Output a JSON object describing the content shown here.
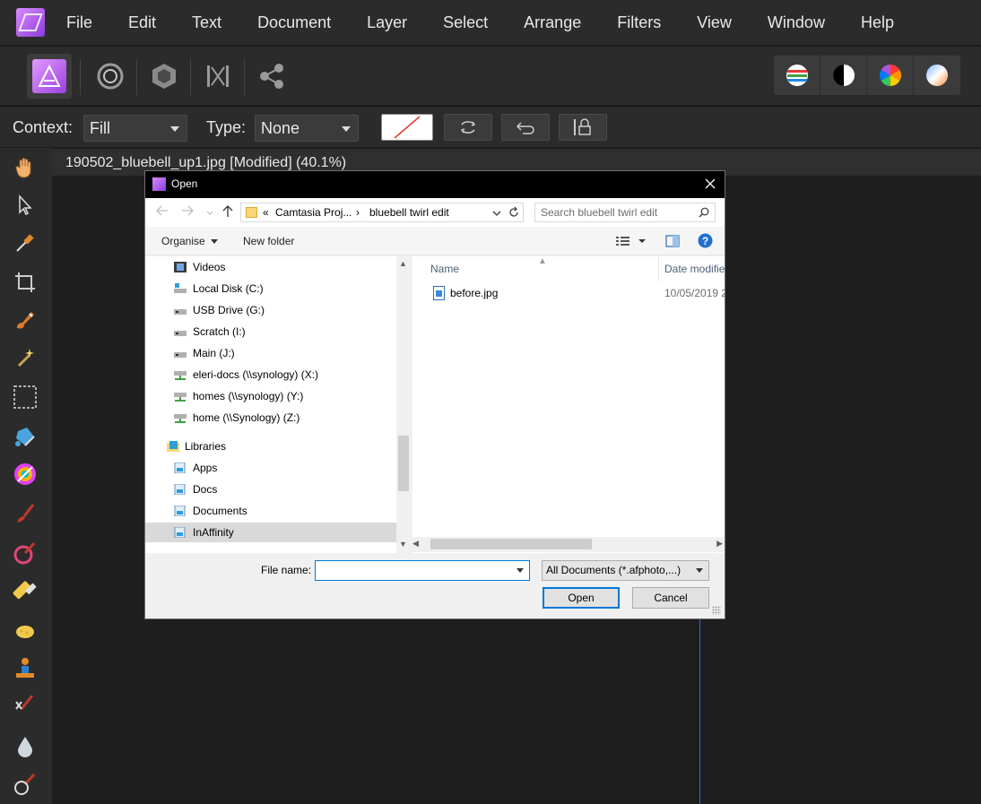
{
  "menu": {
    "items": [
      "File",
      "Edit",
      "Text",
      "Document",
      "Layer",
      "Select",
      "Arrange",
      "Filters",
      "View",
      "Window",
      "Help"
    ]
  },
  "toolbar": {
    "personas": [
      "photo-persona-icon",
      "liquify-persona-icon",
      "develop-persona-icon",
      "tone-mapping-persona-icon",
      "export-persona-icon"
    ],
    "adjustments": [
      "levels-icon",
      "black-white-icon",
      "hsl-icon",
      "white-balance-icon"
    ]
  },
  "context": {
    "context_label": "Context:",
    "context_value": "Fill",
    "type_label": "Type:",
    "type_value": "None"
  },
  "document": {
    "title": "190502_bluebell_up1.jpg [Modified] (40.1%)"
  },
  "dialog": {
    "title": "Open",
    "address": {
      "prefix": "«",
      "segment1": "Camtasia Proj...",
      "separator": "›",
      "segment2": "bluebell twirl edit"
    },
    "search_placeholder": "Search bluebell twirl edit",
    "commands": {
      "organise": "Organise",
      "new_folder": "New folder"
    },
    "nav_items": [
      {
        "label": "Videos",
        "icon": "videos-icon"
      },
      {
        "label": "Local Disk (C:)",
        "icon": "drive-icon"
      },
      {
        "label": "USB Drive (G:)",
        "icon": "drive-icon"
      },
      {
        "label": "Scratch (I:)",
        "icon": "drive-icon"
      },
      {
        "label": "Main (J:)",
        "icon": "drive-icon"
      },
      {
        "label": "eleri-docs (\\\\synology) (X:)",
        "icon": "network-drive-icon"
      },
      {
        "label": "homes (\\\\synology) (Y:)",
        "icon": "network-drive-icon"
      },
      {
        "label": "home (\\\\Synology) (Z:)",
        "icon": "network-drive-icon"
      },
      {
        "label": "Libraries",
        "icon": "libraries-icon"
      },
      {
        "label": "Apps",
        "icon": "library-icon"
      },
      {
        "label": "Docs",
        "icon": "library-icon"
      },
      {
        "label": "Documents",
        "icon": "library-icon"
      },
      {
        "label": "InAffinity",
        "icon": "library-icon"
      }
    ],
    "columns": {
      "name": "Name",
      "date": "Date modifie"
    },
    "files": [
      {
        "name": "before.jpg",
        "date": "10/05/2019 2"
      }
    ],
    "file_name_label": "File name:",
    "file_name_value": "",
    "filter": "All Documents (*.afphoto,...)",
    "open_label": "Open",
    "cancel_label": "Cancel"
  },
  "colors": {
    "accent": "#0078d7",
    "app_bg": "#1e1e1e",
    "panel_bg": "#2b2b2b",
    "guide": "#2b6cd6"
  }
}
